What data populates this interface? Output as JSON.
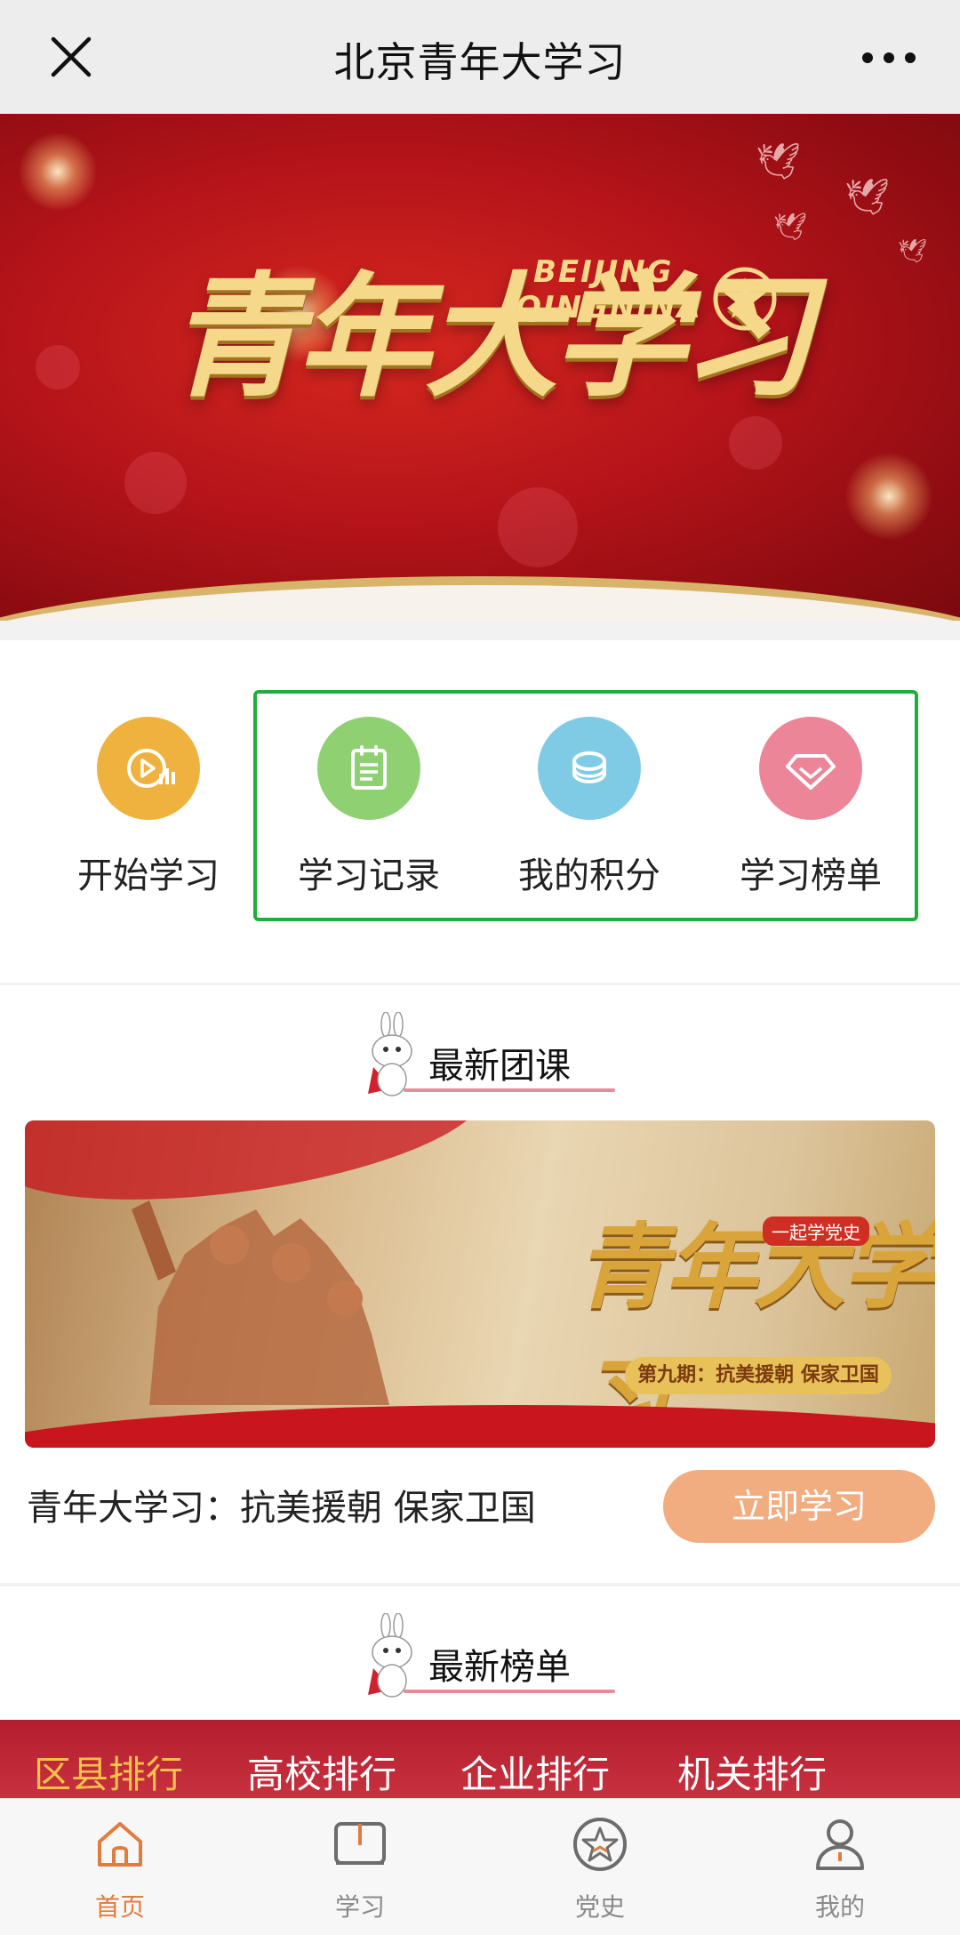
{
  "topbar": {
    "title": "北京青年大学习"
  },
  "banner": {
    "title": "青年大学习",
    "subtitle_line1": "BEIJING",
    "subtitle_line2": "QINGNINA"
  },
  "actions": [
    {
      "label": "开始学习",
      "icon": "play-chart-icon",
      "color": "#f0b23f"
    },
    {
      "label": "学习记录",
      "icon": "notepad-icon",
      "color": "#8fd172"
    },
    {
      "label": "我的积分",
      "icon": "coin-icon",
      "color": "#7fcbe6"
    },
    {
      "label": "学习榜单",
      "icon": "diamond-icon",
      "color": "#eb8597"
    }
  ],
  "course_section": {
    "heading": "最新团课",
    "image_title": "青年大学习",
    "image_tag": "第九期：抗美援朝 保家卫国",
    "image_pill": "一起学党史",
    "course_title": "青年大学习：抗美援朝 保家卫国",
    "button_label": "立即学习"
  },
  "rank_section": {
    "heading": "最新榜单",
    "tabs": [
      "区县排行",
      "高校排行",
      "企业排行",
      "机关排行"
    ],
    "active_tab": 0
  },
  "bottom_nav": [
    {
      "label": "首页",
      "icon": "home-icon",
      "active": true
    },
    {
      "label": "学习",
      "icon": "book-icon",
      "active": false
    },
    {
      "label": "党史",
      "icon": "star-badge-icon",
      "active": false
    },
    {
      "label": "我的",
      "icon": "user-icon",
      "active": false
    }
  ],
  "colors": {
    "accent_orange": "#e27b3e",
    "highlight_green": "#1fae3a",
    "banner_red": "#b5141a",
    "button_peach": "#f1ac80",
    "tab_gold": "#f6c24a"
  }
}
